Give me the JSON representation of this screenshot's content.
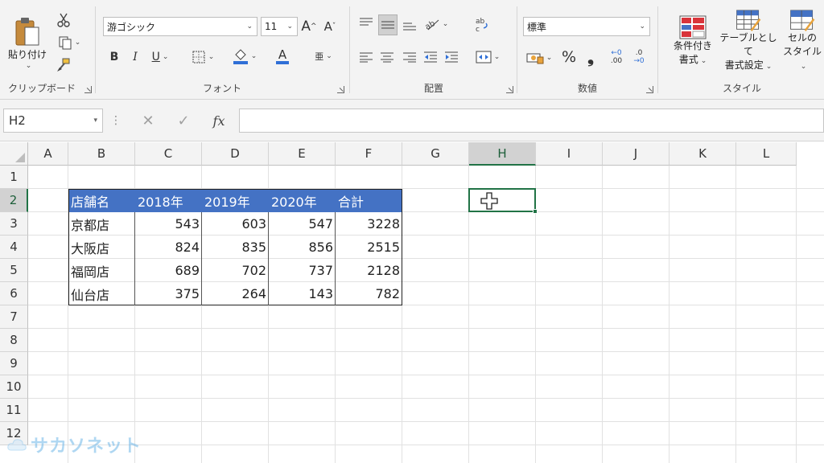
{
  "ribbon": {
    "clipboard": {
      "paste_label": "貼り付け",
      "group_label": "クリップボード"
    },
    "font": {
      "font_name": "游ゴシック",
      "font_size": "11",
      "bold": "B",
      "italic": "I",
      "underline": "U",
      "grow": "A",
      "shrink": "A",
      "font_color": "A",
      "phonetic": "亜",
      "group_label": "フォント"
    },
    "alignment": {
      "group_label": "配置"
    },
    "number": {
      "format": "標準",
      "percent": "%",
      "comma": "❟",
      "inc_decimal": ".00",
      "dec_decimal": ".0",
      "group_label": "数値"
    },
    "styles": {
      "conditional_line1": "条件付き",
      "conditional_line2": "書式",
      "table_line1": "テーブルとして",
      "table_line2": "書式設定",
      "cell_line1": "セルの",
      "cell_line2": "スタイル",
      "group_label": "スタイル"
    }
  },
  "formula_bar": {
    "name_box": "H2",
    "fx": "fx",
    "value": ""
  },
  "grid": {
    "columns": [
      "A",
      "B",
      "C",
      "D",
      "E",
      "F",
      "G",
      "H",
      "I",
      "J",
      "K",
      "L"
    ],
    "rows": [
      "1",
      "2",
      "3",
      "4",
      "5",
      "6",
      "7",
      "8",
      "9",
      "10",
      "11",
      "12"
    ],
    "selected_column": "H",
    "selected_row": "2"
  },
  "table": {
    "headers": [
      "店舗名",
      "2018年",
      "2019年",
      "2020年",
      "合計"
    ],
    "rows": [
      [
        "京都店",
        "543",
        "603",
        "547",
        "3228"
      ],
      [
        "大阪店",
        "824",
        "835",
        "856",
        "2515"
      ],
      [
        "福岡店",
        "689",
        "702",
        "737",
        "2128"
      ],
      [
        "仙台店",
        "375",
        "264",
        "143",
        "782"
      ]
    ],
    "header_color": "#4472c4"
  },
  "watermark": "サカソネット",
  "colors": {
    "accent": "#217346",
    "header_fill": "#4472c4"
  }
}
